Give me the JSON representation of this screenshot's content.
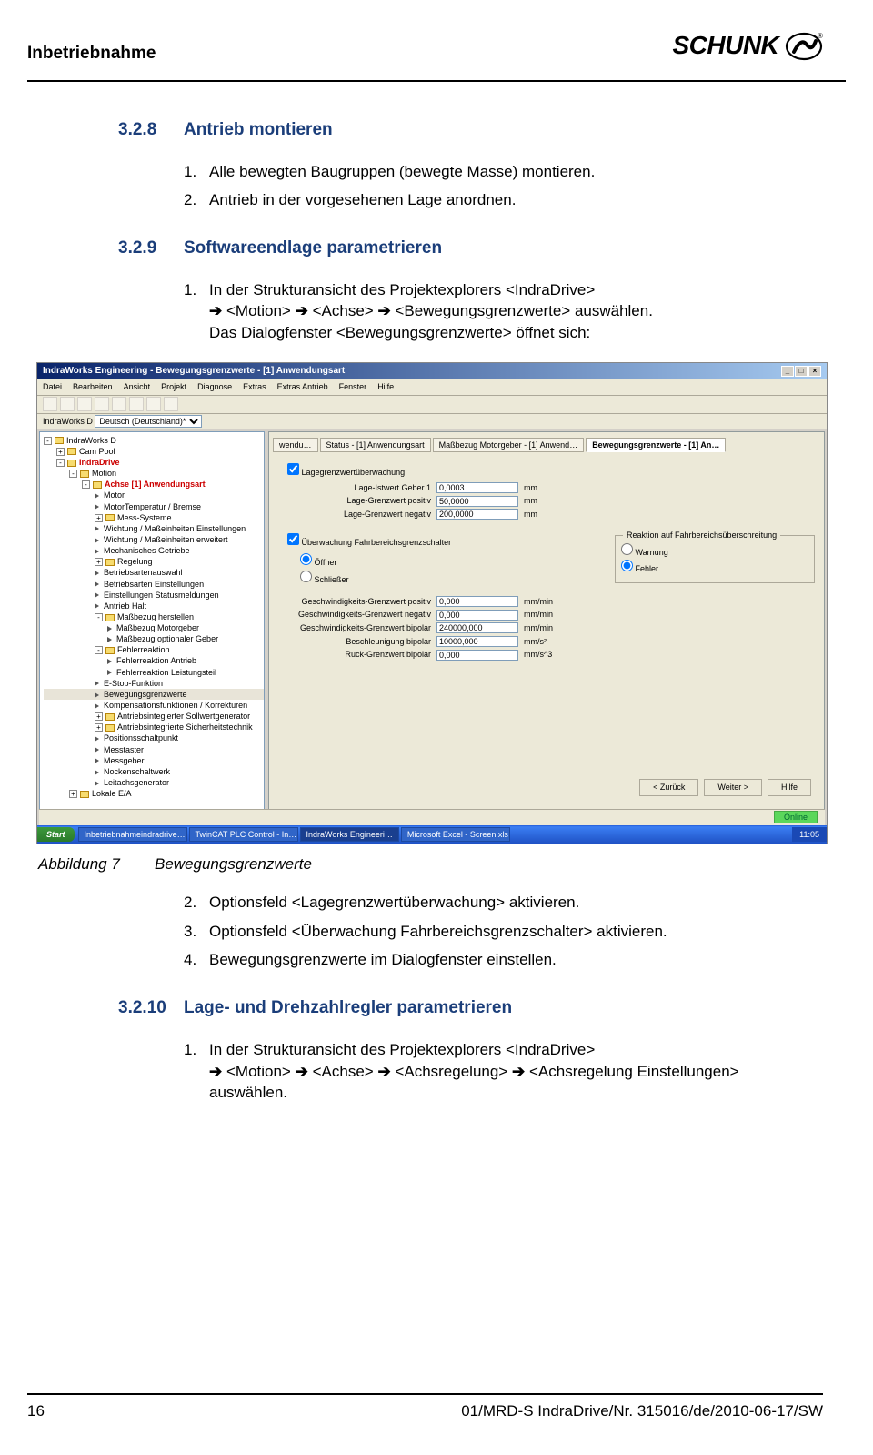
{
  "header": {
    "title": "Inbetriebnahme",
    "logo_text": "SCHUNK"
  },
  "s328": {
    "num": "3.2.8",
    "title": "Antrieb montieren",
    "items": [
      {
        "n": "1.",
        "t": "Alle bewegten Baugruppen (bewegte Masse) montieren."
      },
      {
        "n": "2.",
        "t": "Antrieb in der vorgesehenen Lage anordnen."
      }
    ]
  },
  "s329": {
    "num": "3.2.9",
    "title": "Softwareendlage parametrieren",
    "item1_n": "1.",
    "item1_t1": "In der Strukturansicht des Projektexplorers <IndraDrive>",
    "item1_t2": "<Motion>",
    "item1_t3": "<Achse>",
    "item1_t4": "<Bewegungsgrenzwerte> auswählen.",
    "item1_t5": "Das Dialogfenster <Bewegungsgrenzwerte> öffnet sich:",
    "post_items": [
      {
        "n": "2.",
        "t": "Optionsfeld <Lagegrenzwertüberwachung> aktivieren."
      },
      {
        "n": "3.",
        "t": "Optionsfeld <Überwachung Fahrbereichsgrenzschalter> aktivieren."
      },
      {
        "n": "4.",
        "t": "Bewegungsgrenzwerte im Dialogfenster einstellen."
      }
    ]
  },
  "caption": {
    "label": "Abbildung 7",
    "text": "Bewegungsgrenzwerte"
  },
  "s3210": {
    "num": "3.2.10",
    "title": "Lage- und Drehzahlregler parametrieren",
    "item1_n": "1.",
    "item1_t1": "In der Strukturansicht des Projektexplorers <IndraDrive>",
    "item1_t2": "<Motion>",
    "item1_t3": "<Achse>",
    "item1_t4": "<Achsregelung>",
    "item1_t5": "<Achsregelung Einstellungen> auswählen."
  },
  "footer": {
    "page": "16",
    "doc": "01/MRD-S IndraDrive/Nr. 315016/de/2010-06-17/SW"
  },
  "arrow": "➔",
  "figure": {
    "title": "IndraWorks Engineering - Bewegungsgrenzwerte - [1] Anwendungsart",
    "menu": [
      "Datei",
      "Bearbeiten",
      "Ansicht",
      "Projekt",
      "Diagnose",
      "Extras",
      "Extras Antrieb",
      "Fenster",
      "Hilfe"
    ],
    "lang_label": "IndraWorks D",
    "lang_value": "Deutsch (Deutschland)*",
    "tree": [
      {
        "lvl": 0,
        "box": "-",
        "icon": "folder",
        "label": "IndraWorks D"
      },
      {
        "lvl": 1,
        "box": "+",
        "icon": "folder",
        "label": "Cam Pool"
      },
      {
        "lvl": 1,
        "box": "-",
        "icon": "folder",
        "label": "IndraDrive",
        "cls": "red"
      },
      {
        "lvl": 2,
        "box": "-",
        "icon": "folder",
        "label": "Motion"
      },
      {
        "lvl": 3,
        "box": "-",
        "icon": "folder",
        "label": "Achse [1] Anwendungsart",
        "cls": "red"
      },
      {
        "lvl": 4,
        "box": "",
        "icon": "node",
        "label": "Motor"
      },
      {
        "lvl": 4,
        "box": "",
        "icon": "node",
        "label": "MotorTemperatur / Bremse"
      },
      {
        "lvl": 4,
        "box": "+",
        "icon": "folder",
        "label": "Mess-Systeme"
      },
      {
        "lvl": 4,
        "box": "",
        "icon": "node",
        "label": "Wichtung / Maßeinheiten Einstellungen"
      },
      {
        "lvl": 4,
        "box": "",
        "icon": "node",
        "label": "Wichtung / Maßeinheiten erweitert"
      },
      {
        "lvl": 4,
        "box": "",
        "icon": "node",
        "label": "Mechanisches Getriebe"
      },
      {
        "lvl": 4,
        "box": "+",
        "icon": "folder",
        "label": "Regelung"
      },
      {
        "lvl": 4,
        "box": "",
        "icon": "node",
        "label": "Betriebsartenauswahl"
      },
      {
        "lvl": 4,
        "box": "",
        "icon": "node",
        "label": "Betriebsarten Einstellungen"
      },
      {
        "lvl": 4,
        "box": "",
        "icon": "node",
        "label": "Einstellungen Statusmeldungen"
      },
      {
        "lvl": 4,
        "box": "",
        "icon": "node",
        "label": "Antrieb Halt"
      },
      {
        "lvl": 4,
        "box": "-",
        "icon": "folder",
        "label": "Maßbezug herstellen"
      },
      {
        "lvl": 5,
        "box": "",
        "icon": "node",
        "label": "Maßbezug Motorgeber"
      },
      {
        "lvl": 5,
        "box": "",
        "icon": "node",
        "label": "Maßbezug optionaler Geber"
      },
      {
        "lvl": 4,
        "box": "-",
        "icon": "folder",
        "label": "Fehlerreaktion"
      },
      {
        "lvl": 5,
        "box": "",
        "icon": "node",
        "label": "Fehlerreaktion Antrieb"
      },
      {
        "lvl": 5,
        "box": "",
        "icon": "node",
        "label": "Fehlerreaktion Leistungsteil"
      },
      {
        "lvl": 4,
        "box": "",
        "icon": "node",
        "label": "E-Stop-Funktion"
      },
      {
        "lvl": 4,
        "box": "",
        "icon": "node",
        "label": "Bewegungsgrenzwerte",
        "sel": true
      },
      {
        "lvl": 4,
        "box": "",
        "icon": "node",
        "label": "Kompensationsfunktionen / Korrekturen"
      },
      {
        "lvl": 4,
        "box": "+",
        "icon": "folder",
        "label": "Antriebsintegierter Sollwertgenerator"
      },
      {
        "lvl": 4,
        "box": "+",
        "icon": "folder",
        "label": "Antriebsintegrierte Sicherheitstechnik"
      },
      {
        "lvl": 4,
        "box": "",
        "icon": "node",
        "label": "Positionsschaltpunkt"
      },
      {
        "lvl": 4,
        "box": "",
        "icon": "node",
        "label": "Messtaster"
      },
      {
        "lvl": 4,
        "box": "",
        "icon": "node",
        "label": "Messgeber"
      },
      {
        "lvl": 4,
        "box": "",
        "icon": "node",
        "label": "Nockenschaltwerk"
      },
      {
        "lvl": 4,
        "box": "",
        "icon": "node",
        "label": "Leitachsgenerator"
      },
      {
        "lvl": 2,
        "box": "+",
        "icon": "folder",
        "label": "Lokale E/A"
      }
    ],
    "tabs": [
      "wendu…",
      "Status - [1] Anwendungsart",
      "Maßbezug Motorgeber - [1] Anwend…",
      "Bewegungsgrenzwerte - [1] An…"
    ],
    "active_tab": 3,
    "chk_lage": "Lagegrenzwertüberwachung",
    "fields_lage": [
      {
        "label": "Lage-Istwert Geber 1",
        "value": "0,0003",
        "unit": "mm"
      },
      {
        "label": "Lage-Grenzwert positiv",
        "value": "50,0000",
        "unit": "mm"
      },
      {
        "label": "Lage-Grenzwert negativ",
        "value": "200,0000",
        "unit": "mm"
      }
    ],
    "chk_fahr": "Überwachung Fahrbereichsgrenzschalter",
    "grp_react": "Reaktion auf Fahrbereichsüberschreitung",
    "radios_left": [
      "Öffner",
      "Schließer"
    ],
    "radios_right": [
      "Warnung",
      "Fehler"
    ],
    "radio_left_sel": 0,
    "radio_right_sel": 1,
    "fields_speed": [
      {
        "label": "Geschwindigkeits-Grenzwert positiv",
        "value": "0,000",
        "unit": "mm/min"
      },
      {
        "label": "Geschwindigkeits-Grenzwert negativ",
        "value": "0,000",
        "unit": "mm/min"
      },
      {
        "label": "Geschwindigkeits-Grenzwert bipolar",
        "value": "240000,000",
        "unit": "mm/min"
      },
      {
        "label": "Beschleunigung bipolar",
        "value": "10000,000",
        "unit": "mm/s²"
      },
      {
        "label": "Ruck-Grenzwert bipolar",
        "value": "0,000",
        "unit": "mm/s^3"
      }
    ],
    "buttons": [
      "< Zurück",
      "Weiter >",
      "Hilfe"
    ],
    "status_online": "Online",
    "taskbar": {
      "start": "Start",
      "items": [
        "Inbetriebnahmeindradrive…",
        "TwinCAT PLC Control - In…",
        "IndraWorks Engineeri…",
        "Microsoft Excel - Screen.xls"
      ],
      "active": 2,
      "clock": "11:05"
    }
  }
}
